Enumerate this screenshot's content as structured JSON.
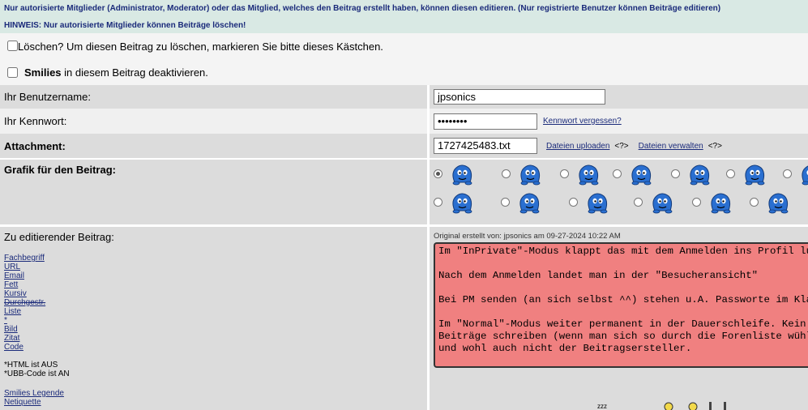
{
  "notice": {
    "line1": "Nur autorisierte Mitglieder (Administrator, Moderator) oder das Mitglied, welches den Beitrag erstellt haben, können diesen editieren. (Nur registrierte Benutzer können Beiträge editieren)",
    "line2": "HINWEIS: Nur autorisierte Mitglieder können Beiträge löschen!"
  },
  "delete_checkbox": {
    "label": "Löschen? Um diesen Beitrag zu löschen, markieren Sie bitte dieses Kästchen."
  },
  "smilies_checkbox": {
    "bold": "Smilies",
    "rest": " in diesem Beitrag deaktivieren."
  },
  "username": {
    "label": "Ihr Benutzername:",
    "value": "jpsonics"
  },
  "password": {
    "label": "Ihr Kennwort:",
    "value": "••••••••",
    "forgot_link": "Kennwort vergessen?"
  },
  "attachment": {
    "label": "Attachment:",
    "value": "1727425483.txt",
    "upload_link": "Dateien uploaden",
    "upload_help": "<?>",
    "manage_link": "Dateien verwalten",
    "manage_help": "<?>"
  },
  "graphic": {
    "label": "Grafik für den Beitrag:",
    "selected_index": 0,
    "icon_count": 14
  },
  "edit": {
    "label": "Zu editierender Beitrag:",
    "ubb_links": [
      "Fachbegriff",
      "URL",
      "Email",
      "Fett",
      "Kursiv",
      "Durchgestr.",
      "Liste",
      "*",
      "Bild",
      "Zitat",
      "Code"
    ],
    "html_status": "*HTML ist AUS",
    "ubb_status": "*UBB-Code ist AN",
    "smilies_legend": "Smilies Legende",
    "netiquette": "Netiquette",
    "original_info": "Original erstellt von: jpsonics am 09-27-2024 10:22 AM",
    "post_lines": [
      "Im \"InPrivate\"-Modus klappt das mit dem Anmelden ins Profil lus",
      "Nach dem Anmelden landet man in der \"Besucheransicht\"",
      "Bei PM senden (an sich selbst ^^) stehen u.A. Passworte im Klar",
      "Im \"Normal\"-Modus weiter permanent in der Dauerschleife. Kein a",
      "Beiträge schreiben (wenn man sich so durch die Forenliste wühlt",
      "und wohl auch nicht der Beitragsersteller."
    ]
  },
  "colors": {
    "notice_bg": "#d9e9e4",
    "notice_text": "#1a2a7a",
    "post_bg": "#f08080",
    "smiley_blue": "#2a6fd0"
  }
}
